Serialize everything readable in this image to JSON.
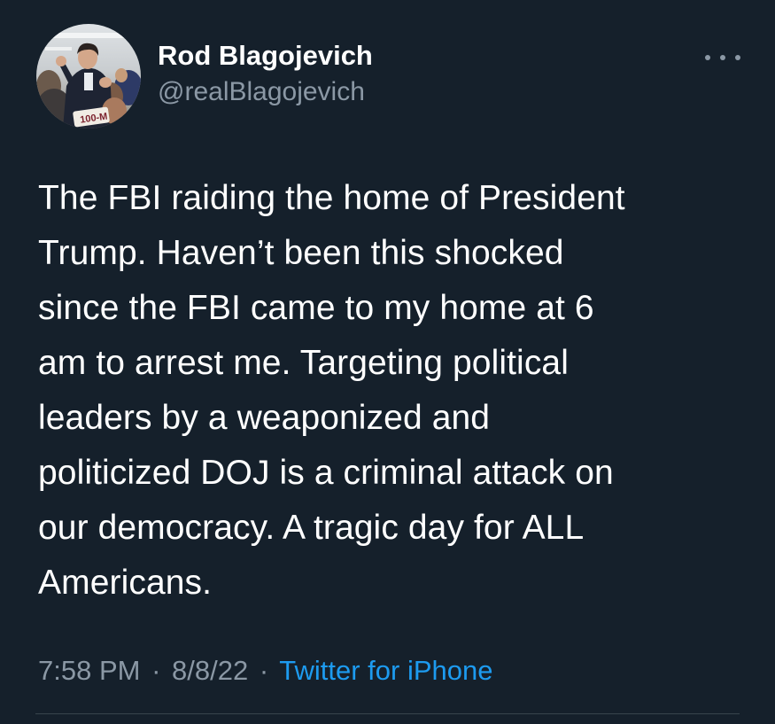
{
  "user": {
    "display_name": "Rod Blagojevich",
    "handle": "@realBlagojevich",
    "avatar_sign_text": "100-M"
  },
  "tweet": {
    "text_lines": [
      "The FBI raiding the home of President",
      "Trump.  Haven’t been this shocked",
      "since the FBI came to my home at 6",
      "am to arrest me. Targeting political",
      "leaders by a weaponized and",
      "politicized DOJ is a criminal attack on",
      "our democracy. A tragic day for ALL",
      "Americans."
    ],
    "time": "7:58 PM",
    "date": "8/8/22",
    "separator": "·",
    "source": "Twitter for iPhone"
  },
  "colors": {
    "background": "#15202b",
    "primary_text": "#ffffff",
    "secondary_text": "#8b98a5",
    "link": "#1d9bf0",
    "divider": "#38444d"
  },
  "icons": {
    "more_menu": "more-horizontal-icon"
  }
}
